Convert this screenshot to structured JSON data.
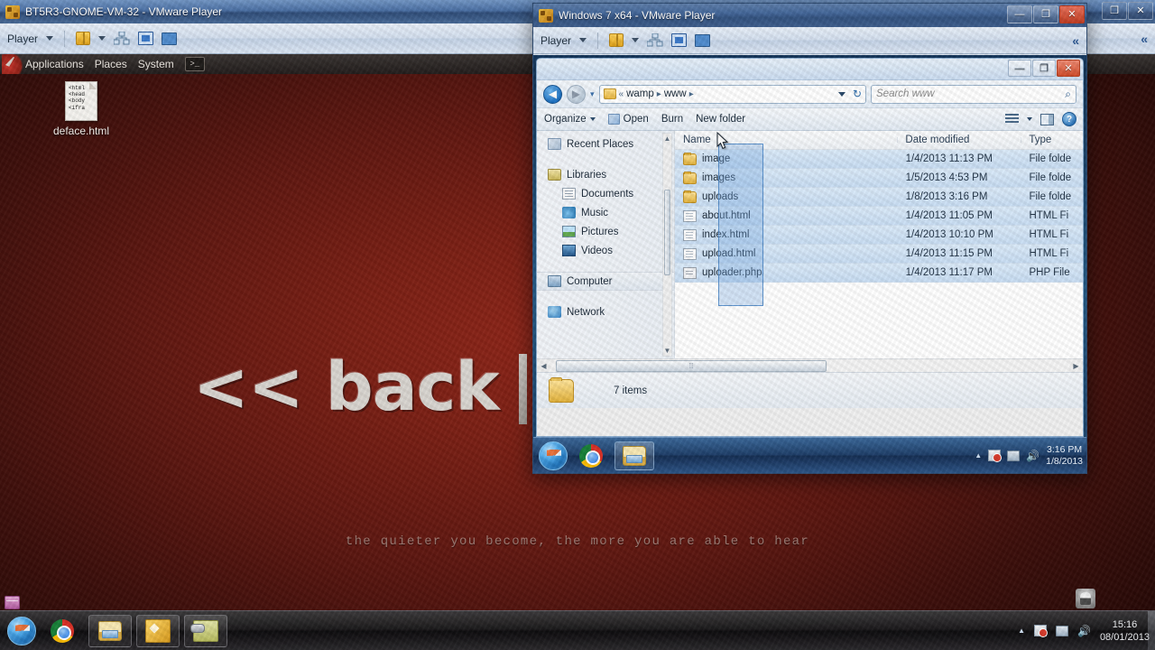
{
  "host": {
    "taskbar": {
      "start_label": "Start",
      "buttons": [
        {
          "name": "chrome",
          "label": "Google Chrome"
        },
        {
          "name": "explorer",
          "label": "Windows Explorer"
        },
        {
          "name": "vmware",
          "label": "VMware Player"
        },
        {
          "name": "tool",
          "label": "Tool"
        }
      ],
      "tray": {
        "show_hidden": "▲",
        "flag": "action-center",
        "network": "network",
        "volume": "🔊",
        "time": "15:16",
        "date": "08/01/2013"
      }
    }
  },
  "outer_vm": {
    "title": "BT5R3-GNOME-VM-32 - VMware Player",
    "toolbar": {
      "player_label": "Player",
      "collapse": "«"
    },
    "window_buttons": {
      "restore": "❐",
      "close": "✕"
    },
    "gnome_panel": {
      "items": [
        "Applications",
        "Places",
        "System"
      ],
      "terminal_glyph": ">_"
    },
    "desktop": {
      "icon": {
        "label": "deface.html",
        "preview_lines": [
          "<html",
          "<head",
          "<body",
          "<ifra"
        ]
      },
      "wallpaper_logo": "<< back",
      "wallpaper_tagline": "the quieter you become, the more you are able to hear"
    }
  },
  "inner_vm": {
    "title": "Windows 7 x64 - VMware Player",
    "toolbar": {
      "player_label": "Player",
      "collapse": "«"
    },
    "window_buttons": {
      "minimize": "—",
      "restore": "❐",
      "close": "✕"
    }
  },
  "explorer": {
    "window_buttons": {
      "minimize": "—",
      "restore": "❐",
      "close": "✕"
    },
    "breadcrumb": {
      "prefix": "«",
      "parts": [
        "wamp",
        "www"
      ],
      "separator": "▸",
      "refresh": "↻"
    },
    "search": {
      "placeholder": "Search www",
      "icon": "search-icon"
    },
    "command_bar": {
      "organize": "Organize",
      "open": "Open",
      "burn": "Burn",
      "new_folder": "New folder",
      "help": "?"
    },
    "nav_pane": {
      "items": [
        {
          "label": "Recent Places",
          "icon": "recent-places-icon",
          "indent": false,
          "gap_before": false
        },
        {
          "label": "Libraries",
          "icon": "libraries-icon",
          "indent": false,
          "gap_before": true
        },
        {
          "label": "Documents",
          "icon": "documents-icon",
          "indent": true,
          "gap_before": false
        },
        {
          "label": "Music",
          "icon": "music-icon",
          "indent": true,
          "gap_before": false
        },
        {
          "label": "Pictures",
          "icon": "pictures-icon",
          "indent": true,
          "gap_before": false
        },
        {
          "label": "Videos",
          "icon": "videos-icon",
          "indent": true,
          "gap_before": false
        },
        {
          "label": "Computer",
          "icon": "computer-icon",
          "indent": false,
          "gap_before": true
        },
        {
          "label": "Network",
          "icon": "network-icon",
          "indent": false,
          "gap_before": true
        }
      ]
    },
    "columns": {
      "name": "Name",
      "date_modified": "Date modified",
      "type": "Type"
    },
    "files": [
      {
        "name": "image",
        "date": "1/4/2013 11:13 PM",
        "type": "File folde",
        "icon": "folder-icon"
      },
      {
        "name": "images",
        "date": "1/5/2013 4:53 PM",
        "type": "File folde",
        "icon": "folder-icon"
      },
      {
        "name": "uploads",
        "date": "1/8/2013 3:16 PM",
        "type": "File folde",
        "icon": "folder-icon"
      },
      {
        "name": "about.html",
        "date": "1/4/2013 11:05 PM",
        "type": "HTML Fi",
        "icon": "html-file-icon"
      },
      {
        "name": "index.html",
        "date": "1/4/2013 10:10 PM",
        "type": "HTML Fi",
        "icon": "html-file-icon"
      },
      {
        "name": "upload.html",
        "date": "1/4/2013 11:15 PM",
        "type": "HTML Fi",
        "icon": "html-file-icon"
      },
      {
        "name": "uploader.php",
        "date": "1/4/2013 11:17 PM",
        "type": "PHP File",
        "icon": "php-file-icon"
      }
    ],
    "status": {
      "item_count": "7 items"
    }
  },
  "guest_taskbar": {
    "tray": {
      "show_hidden": "▲",
      "time": "3:16 PM",
      "date": "1/8/2013"
    }
  }
}
